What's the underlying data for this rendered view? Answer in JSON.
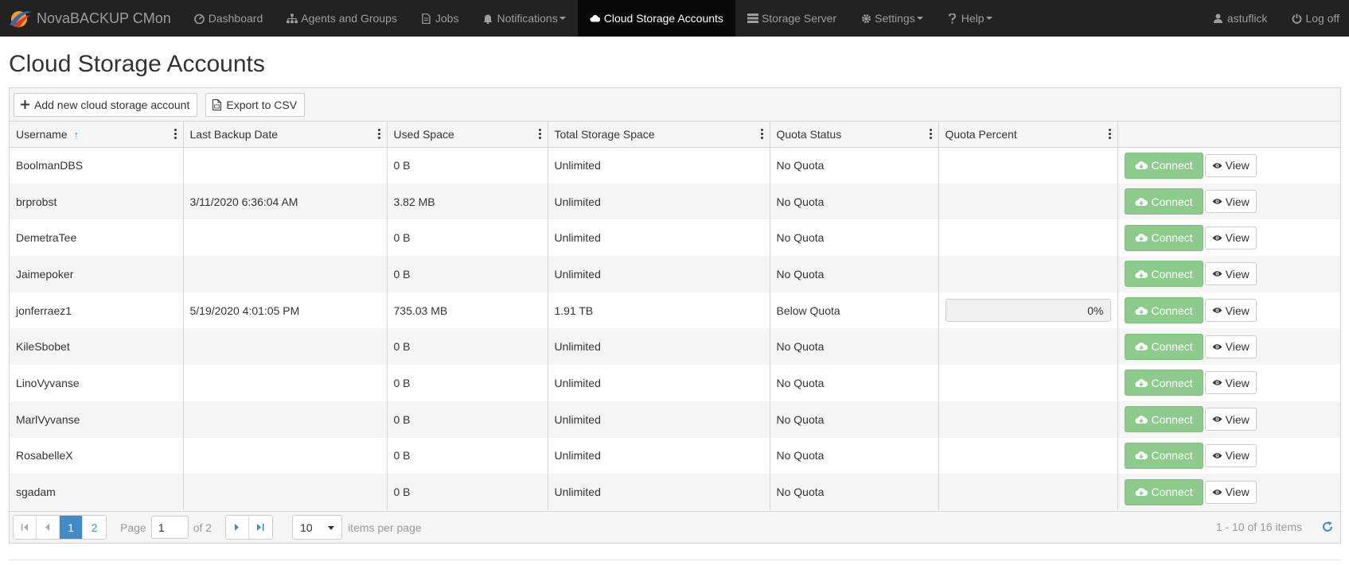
{
  "app": {
    "brand": "NovaBACKUP CMon"
  },
  "nav": {
    "items": [
      {
        "label": "Dashboard",
        "icon": "dashboard-icon"
      },
      {
        "label": "Agents and Groups",
        "icon": "sitemap-icon"
      },
      {
        "label": "Jobs",
        "icon": "document-icon"
      },
      {
        "label": "Notifications",
        "icon": "bell-icon",
        "caret": true
      },
      {
        "label": "Cloud Storage Accounts",
        "icon": "cloud-icon",
        "active": true
      },
      {
        "label": "Storage Server",
        "icon": "server-icon"
      },
      {
        "label": "Settings",
        "icon": "gear-icon",
        "caret": true
      },
      {
        "label": "Help",
        "icon": "question-icon",
        "caret": true
      }
    ],
    "user": "astuflick",
    "logoff": "Log off"
  },
  "page": {
    "title": "Cloud Storage Accounts"
  },
  "toolbar": {
    "add_label": "Add new cloud storage account",
    "export_label": "Export to CSV"
  },
  "table": {
    "columns": [
      "Username",
      "Last Backup Date",
      "Used Space",
      "Total Storage Space",
      "Quota Status",
      "Quota Percent",
      ""
    ],
    "sort_column": "Username",
    "connect_label": "Connect",
    "view_label": "View",
    "rows": [
      {
        "username": "BoolmanDBS",
        "last_backup": "",
        "used": "0 B",
        "total": "Unlimited",
        "quota_status": "No Quota",
        "quota_percent": null
      },
      {
        "username": "brprobst",
        "last_backup": "3/11/2020 6:36:04 AM",
        "used": "3.82 MB",
        "total": "Unlimited",
        "quota_status": "No Quota",
        "quota_percent": null
      },
      {
        "username": "DemetraTee",
        "last_backup": "",
        "used": "0 B",
        "total": "Unlimited",
        "quota_status": "No Quota",
        "quota_percent": null
      },
      {
        "username": "Jaimepoker",
        "last_backup": "",
        "used": "0 B",
        "total": "Unlimited",
        "quota_status": "No Quota",
        "quota_percent": null
      },
      {
        "username": "jonferraez1",
        "last_backup": "5/19/2020 4:01:05 PM",
        "used": "735.03 MB",
        "total": "1.91 TB",
        "quota_status": "Below Quota",
        "quota_percent": "0%"
      },
      {
        "username": "KileSbobet",
        "last_backup": "",
        "used": "0 B",
        "total": "Unlimited",
        "quota_status": "No Quota",
        "quota_percent": null
      },
      {
        "username": "LinoVyvanse",
        "last_backup": "",
        "used": "0 B",
        "total": "Unlimited",
        "quota_status": "No Quota",
        "quota_percent": null
      },
      {
        "username": "MarlVyvanse",
        "last_backup": "",
        "used": "0 B",
        "total": "Unlimited",
        "quota_status": "No Quota",
        "quota_percent": null
      },
      {
        "username": "RosabelleX",
        "last_backup": "",
        "used": "0 B",
        "total": "Unlimited",
        "quota_status": "No Quota",
        "quota_percent": null
      },
      {
        "username": "sgadam",
        "last_backup": "",
        "used": "0 B",
        "total": "Unlimited",
        "quota_status": "No Quota",
        "quota_percent": null
      }
    ]
  },
  "pager": {
    "pages": [
      "1",
      "2"
    ],
    "current_page": "1",
    "page_label": "Page",
    "page_value": "1",
    "of_label": "of 2",
    "page_size": "10",
    "items_per_page_label": "items per page",
    "info": "1 - 10 of 16 items"
  },
  "colors": {
    "navbar": "#222222",
    "accent": "#428bca",
    "connect": "#8ccb8c",
    "progress_fill": "#5cb85c"
  }
}
